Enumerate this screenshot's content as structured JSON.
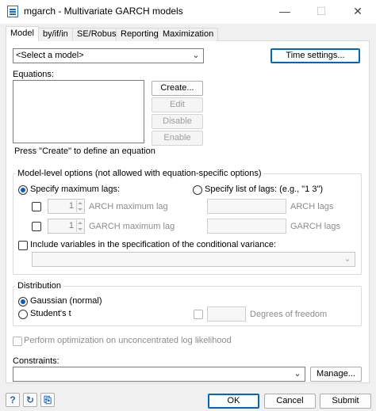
{
  "window": {
    "title": "mgarch - Multivariate GARCH models",
    "minimize_glyph": "—",
    "maximize_glyph": "☐",
    "close_glyph": "✕"
  },
  "tabs": [
    {
      "label": "Model"
    },
    {
      "label": "by/if/in"
    },
    {
      "label": "SE/Robust"
    },
    {
      "label": "Reporting"
    },
    {
      "label": "Maximization"
    }
  ],
  "model": {
    "select_value": "<Select a model>",
    "time_settings_label": "Time settings..."
  },
  "equations": {
    "label": "Equations:",
    "create_label": "Create...",
    "edit_label": "Edit",
    "disable_label": "Disable",
    "enable_label": "Enable",
    "hint": "Press \"Create\" to define an equation"
  },
  "model_level": {
    "group_label": "Model-level options (not allowed with equation-specific options)",
    "max_lags_label": "Specify maximum lags:",
    "list_lags_label": "Specify list of lags: (e.g., \"1 3\")",
    "arch_value": "1",
    "arch_max_label": "ARCH maximum lag",
    "garch_value": "1",
    "garch_max_label": "GARCH maximum lag",
    "arch_lags_label": "ARCH lags",
    "garch_lags_label": "GARCH lags",
    "include_vars_label": "Include variables in the specification of the conditional variance:"
  },
  "distribution": {
    "group_label": "Distribution",
    "gaussian_label": "Gaussian (normal)",
    "students_label": "Student's t",
    "dof_label": "Degrees of freedom"
  },
  "unconcentrated_label": "Perform optimization on unconcentrated log likelihood",
  "constraints": {
    "label": "Constraints:",
    "manage_label": "Manage..."
  },
  "footer": {
    "help_glyph": "?",
    "reset_glyph": "↻",
    "copy_glyph": "⎘",
    "ok_label": "OK",
    "cancel_label": "Cancel",
    "submit_label": "Submit"
  },
  "colors": {
    "accent": "#0067c0",
    "radio_dot": "#0b5cbf"
  }
}
